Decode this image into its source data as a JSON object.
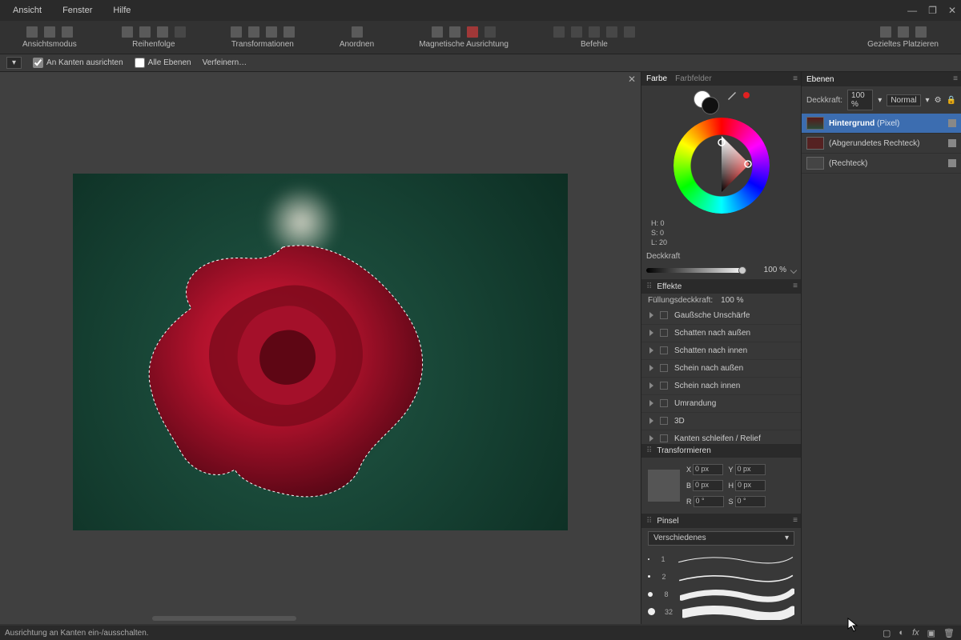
{
  "menu": {
    "items": [
      "Ansicht",
      "Fenster",
      "Hilfe"
    ]
  },
  "ribbon": {
    "groups": [
      "Ansichtsmodus",
      "Reihenfolge",
      "Transformationen",
      "Anordnen",
      "Magnetische Ausrichtung",
      "Befehle",
      "Gezieltes Platzieren"
    ]
  },
  "context": {
    "snap_label": "An Kanten ausrichten",
    "all_layers": "Alle Ebenen",
    "refine": "Verfeinern…"
  },
  "panels": {
    "color": {
      "tab_color": "Farbe",
      "tab_swatches": "Farbfelder",
      "h": "H: 0",
      "s": "S: 0",
      "l": "L: 20",
      "opacity_label": "Deckkraft",
      "opacity_value": "100 %"
    },
    "effects": {
      "title": "Effekte",
      "fill_opacity_label": "Füllungsdeckkraft:",
      "fill_opacity_value": "100 %",
      "items": [
        "Gaußsche Unschärfe",
        "Schatten nach außen",
        "Schatten nach innen",
        "Schein nach außen",
        "Schein nach innen",
        "Umrandung",
        "3D",
        "Kanten schleifen / Relief"
      ]
    },
    "transform": {
      "title": "Transformieren",
      "x": "0 px",
      "y": "0 px",
      "w": "0 px",
      "h": "0 px",
      "r": "0 °",
      "s": "0 °"
    },
    "brush": {
      "title": "Pinsel",
      "category": "Verschiedenes",
      "sizes": [
        "1",
        "2",
        "8",
        "32"
      ]
    },
    "layers": {
      "title": "Ebenen",
      "opacity_label": "Deckkraft:",
      "opacity_value": "100 %",
      "blend": "Normal",
      "items": [
        {
          "name": "Hintergrund",
          "suffix": "(Pixel)",
          "selected": true
        },
        {
          "name": "(Abgerundetes Rechteck)",
          "suffix": "",
          "selected": false
        },
        {
          "name": "(Rechteck)",
          "suffix": "",
          "selected": false
        }
      ]
    }
  },
  "status": "Ausrichtung an Kanten ein-/ausschalten."
}
